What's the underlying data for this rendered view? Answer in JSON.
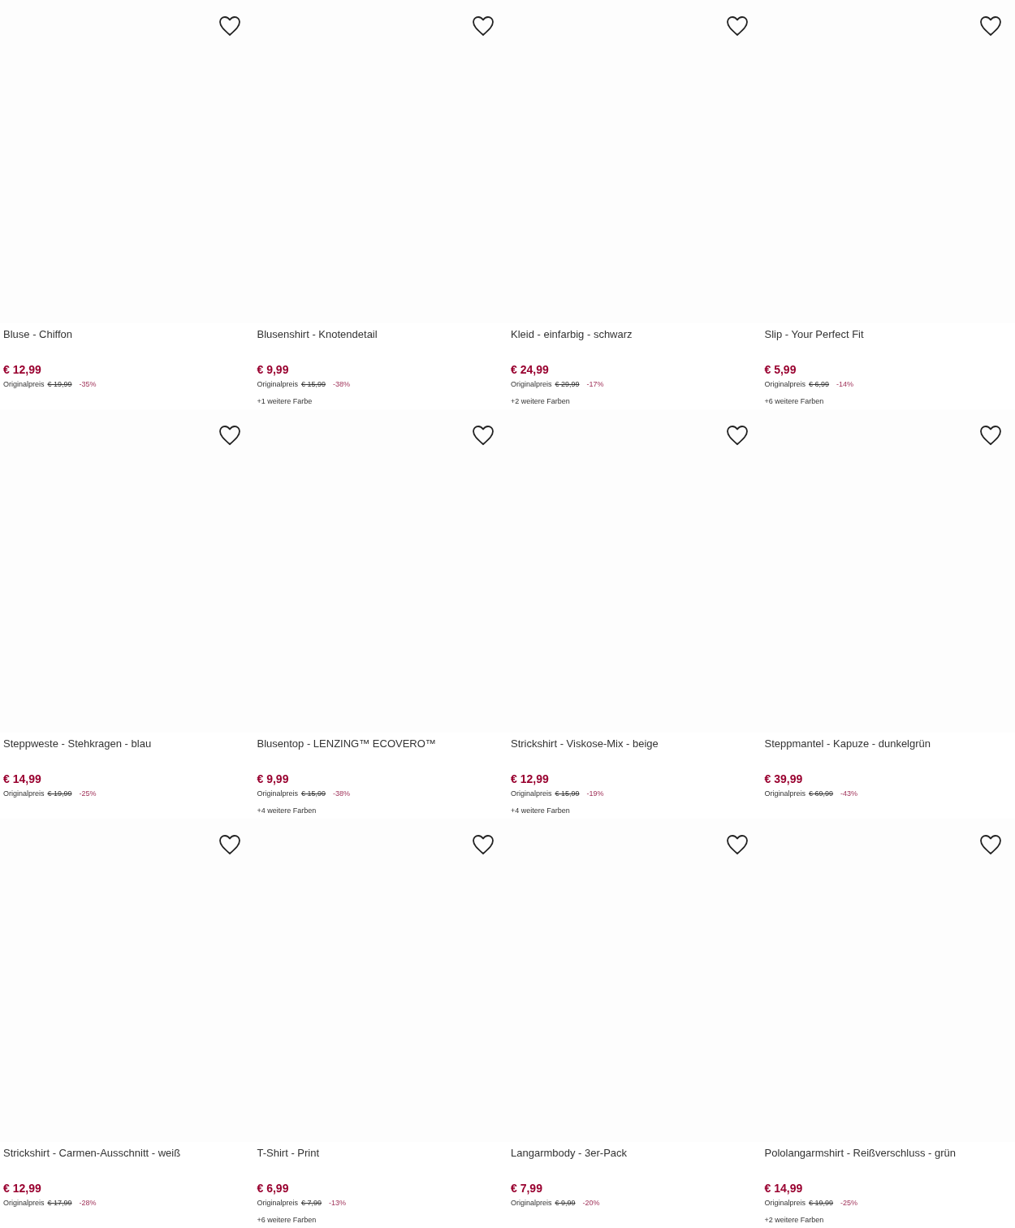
{
  "products": [
    {
      "title": "Bluse - Chiffon",
      "price": "€ 12,99",
      "original_label": "Originalpreis",
      "original_price": "€ 19,99",
      "discount": "-35%"
    },
    {
      "title": "Blusenshirt - Knotendetail",
      "price": "€ 9,99",
      "original_label": "Originalpreis",
      "original_price": "€ 15,99",
      "discount": "-38%",
      "more_colors": "+1 weitere Farbe"
    },
    {
      "title": "Kleid - einfarbig - schwarz",
      "price": "€ 24,99",
      "original_label": "Originalpreis",
      "original_price": "€ 29,99",
      "discount": "-17%",
      "more_colors": "+2 weitere Farben"
    },
    {
      "title": "Slip - Your Perfect Fit",
      "price": "€ 5,99",
      "original_label": "Originalpreis",
      "original_price": "€ 6,99",
      "discount": "-14%",
      "more_colors": "+6 weitere Farben"
    },
    {
      "title": "Steppweste - Stehkragen - blau",
      "price": "€ 14,99",
      "original_label": "Originalpreis",
      "original_price": "€ 19,99",
      "discount": "-25%"
    },
    {
      "title": "Blusentop - LENZING™ ECOVERO™",
      "price": "€ 9,99",
      "original_label": "Originalpreis",
      "original_price": "€ 15,99",
      "discount": "-38%",
      "more_colors": "+4 weitere Farben"
    },
    {
      "title": "Strickshirt - Viskose-Mix - beige",
      "price": "€ 12,99",
      "original_label": "Originalpreis",
      "original_price": "€ 15,99",
      "discount": "-19%",
      "more_colors": "+4 weitere Farben"
    },
    {
      "title": "Steppmantel - Kapuze - dunkelgrün",
      "price": "€ 39,99",
      "original_label": "Originalpreis",
      "original_price": "€ 69,99",
      "discount": "-43%"
    },
    {
      "title": "Strickshirt - Carmen-Ausschnitt - weiß",
      "price": "€ 12,99",
      "original_label": "Originalpreis",
      "original_price": "€ 17,99",
      "discount": "-28%"
    },
    {
      "title": "T-Shirt - Print",
      "price": "€ 6,99",
      "original_label": "Originalpreis",
      "original_price": "€ 7,99",
      "discount": "-13%",
      "more_colors": "+6 weitere Farben"
    },
    {
      "title": "Langarmbody - 3er-Pack",
      "price": "€ 7,99",
      "original_label": "Originalpreis",
      "original_price": "€ 9,99",
      "discount": "-20%"
    },
    {
      "title": "Pololangarmshirt - Reißverschluss - grün",
      "price": "€ 14,99",
      "original_label": "Originalpreis",
      "original_price": "€ 19,99",
      "discount": "-25%",
      "more_colors": "+2 weitere Farben"
    }
  ]
}
